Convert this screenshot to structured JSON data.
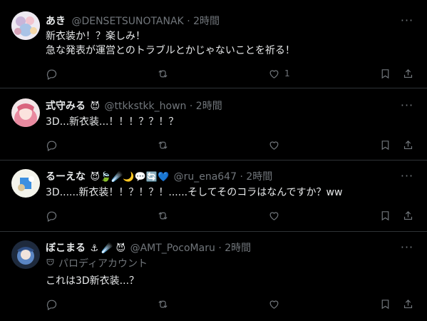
{
  "posts": [
    {
      "name": "あき",
      "name_emojis": "",
      "handle": "@DENSETSUNOTANAK",
      "time": "2時間",
      "parody_label": "",
      "lines": [
        "新衣装か！？楽しみ！",
        "急な発表が運営とのトラブルとかじゃないことを祈る！"
      ],
      "like_count": "1"
    },
    {
      "name": "式守みる",
      "name_emojis": "😈",
      "handle": "@ttkkstkk_hown",
      "time": "2時間",
      "parody_label": "",
      "lines": [
        "3D...新衣装...！！！？？！？"
      ],
      "like_count": ""
    },
    {
      "name": "るーえな",
      "name_emojis": "😈🍃☄️🌙💬🔄💙",
      "handle": "@ru_ena647",
      "time": "2時間",
      "parody_label": "",
      "lines": [
        "3D......新衣装！！？！？！......そしてそのコラはなんですか？ww"
      ],
      "like_count": ""
    },
    {
      "name": "ぼこまる",
      "name_emojis": "⚓ ☄️ 😈",
      "handle": "@AMT_PocoMaru",
      "time": "2時間",
      "parody_label": "パロディアカウント",
      "lines": [
        "これは3D新衣装...？"
      ],
      "like_count": ""
    }
  ]
}
